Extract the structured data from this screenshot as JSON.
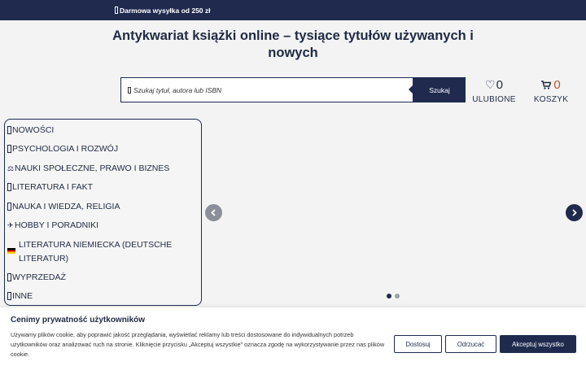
{
  "topbar": {
    "shipping_text": "Darmowa wysyłka od 250 zł"
  },
  "header": {
    "title": "Antykwariat książki online – tysiące tytułów używanych i nowych"
  },
  "search": {
    "placeholder": "Szukaj tytuł, autora lub ISBN",
    "button_label": "Szukaj"
  },
  "favorites": {
    "count": "0",
    "label": "ULUBIONE"
  },
  "cart": {
    "count": "0",
    "label": "KOSZYK"
  },
  "menu": {
    "items": [
      {
        "label": "NOWOŚCI",
        "icon": "square-icon"
      },
      {
        "label": "PSYCHOLOGIA I ROZWÓJ",
        "icon": "square-icon"
      },
      {
        "label": "NAUKI SPOŁECZNE, PRAWO I BIZNES",
        "icon": "scales-icon"
      },
      {
        "label": "LITERATURA I FAKT",
        "icon": "square-icon"
      },
      {
        "label": "NAUKA I WIEDZA, RELIGIA",
        "icon": "square-icon"
      },
      {
        "label": "HOBBY I PORADNIKI",
        "icon": "airplane-icon"
      },
      {
        "label": "LITERATURA NIEMIECKA (DEUTSCHE LITERATUR)",
        "icon": "german-flag-icon"
      },
      {
        "label": "WYPRZEDAŻ",
        "icon": "square-icon"
      },
      {
        "label": "INNE",
        "icon": "square-icon"
      }
    ]
  },
  "carousel": {
    "slide_count": 2,
    "active_slide": 1
  },
  "cookie": {
    "title": "Cenimy prywatność użytkowników",
    "text": "Używamy plików cookie, aby poprawić jakość przeglądania, wyświetlać reklamy lub treści dostosowane do indywidualnych potrzeb użytkowników oraz analizować ruch na stronie. Kliknięcie przycisku „Akceptuj wszystkie” oznacza zgodę na wykorzystywanie przez nas plików cookie.",
    "customize_label": "Dostosuj",
    "reject_label": "Odrzucać",
    "accept_label": "Akceptuj wszystko"
  },
  "colors": {
    "navy": "#1f2a4e",
    "accent_orange": "#c0532a",
    "background": "#f3f3f3"
  }
}
